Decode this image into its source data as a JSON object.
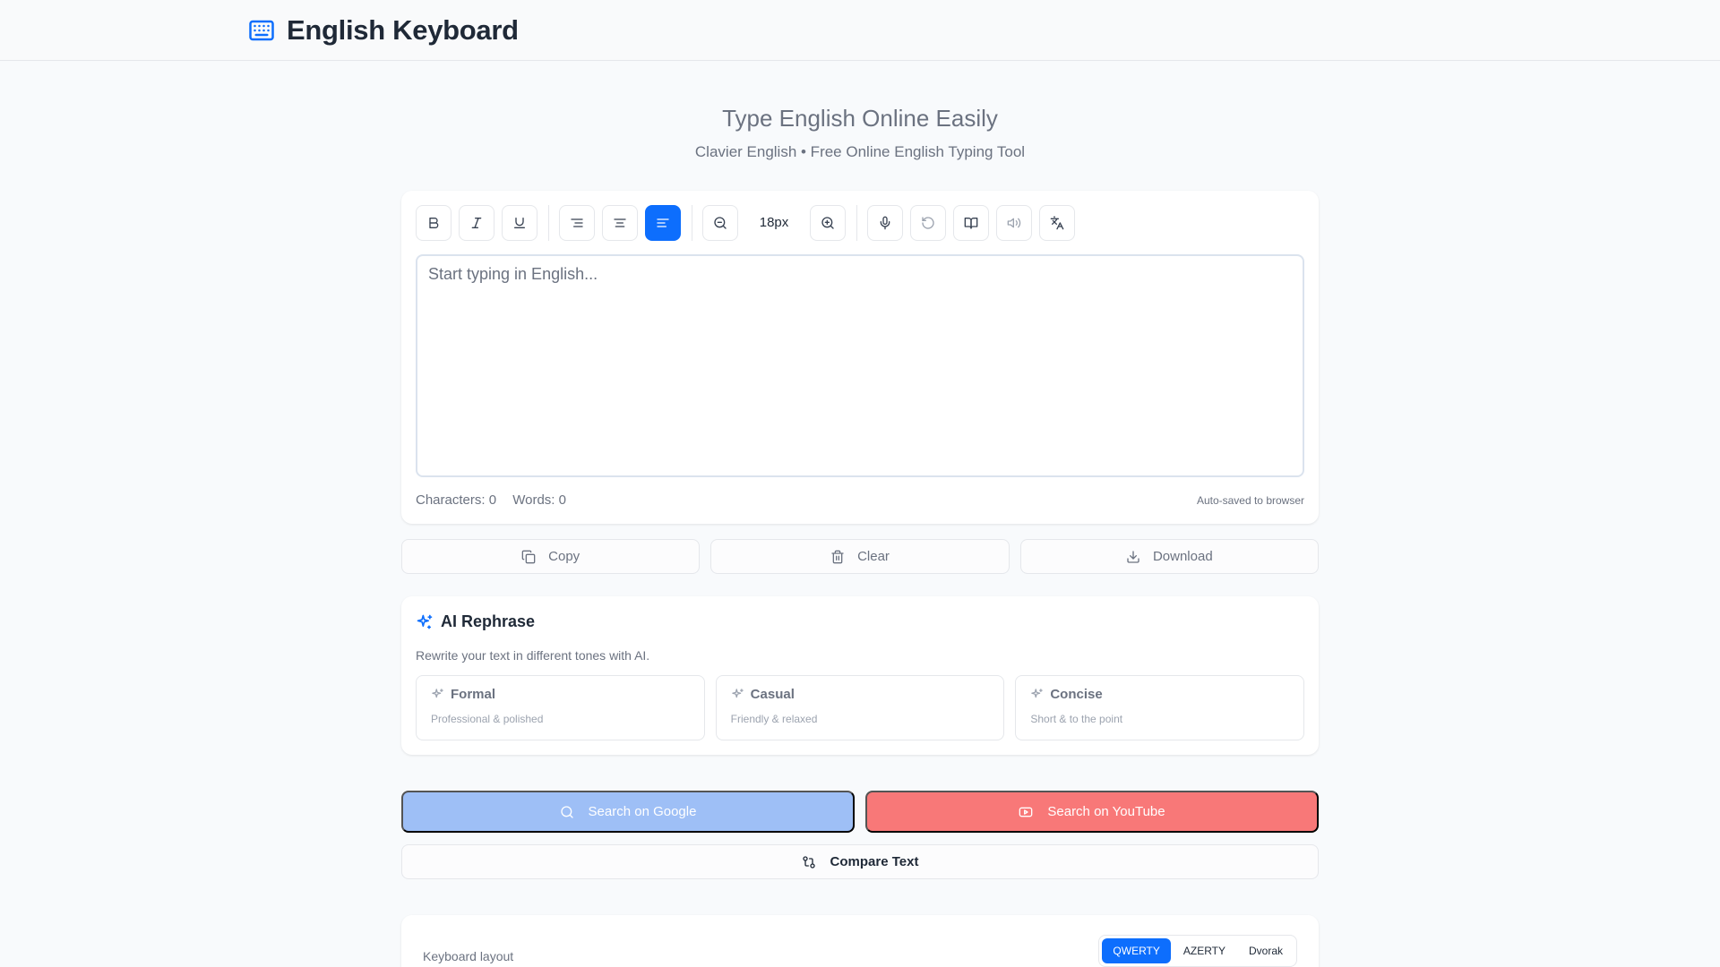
{
  "header": {
    "title": "English Keyboard",
    "logo_icon": "keyboard-icon"
  },
  "hero": {
    "title": "Type English Online Easily",
    "subtitle": "Clavier English • Free Online English Typing Tool"
  },
  "toolbar": {
    "font_size": "18px",
    "active_align": "align-left",
    "buttons": [
      "bold",
      "italic",
      "underline",
      "align-right",
      "align-center",
      "align-left",
      "zoom-out",
      "zoom-in",
      "microphone",
      "undo",
      "dictionary",
      "speak",
      "translate"
    ]
  },
  "editor": {
    "placeholder": "Start typing in English...",
    "value": "",
    "characters_label": "Characters: 0",
    "words_label": "Words: 0",
    "autosave": "Auto-saved to browser"
  },
  "actions": {
    "copy": "Copy",
    "clear": "Clear",
    "download": "Download"
  },
  "rephrase": {
    "title": "AI Rephrase",
    "description": "Rewrite your text in different tones with AI.",
    "tones": [
      {
        "name": "Formal",
        "desc": "Professional & polished"
      },
      {
        "name": "Casual",
        "desc": "Friendly & relaxed"
      },
      {
        "name": "Concise",
        "desc": "Short & to the point"
      }
    ]
  },
  "search": {
    "google": "Search on Google",
    "youtube": "Search on YouTube",
    "compare": "Compare Text"
  },
  "keyboard": {
    "label": "Keyboard layout",
    "layouts": [
      "QWERTY",
      "AZERTY",
      "Dvorak"
    ],
    "active": "QWERTY"
  },
  "colors": {
    "accent": "#0d6efd",
    "google": "#9ebff6",
    "youtube": "#f87878"
  }
}
